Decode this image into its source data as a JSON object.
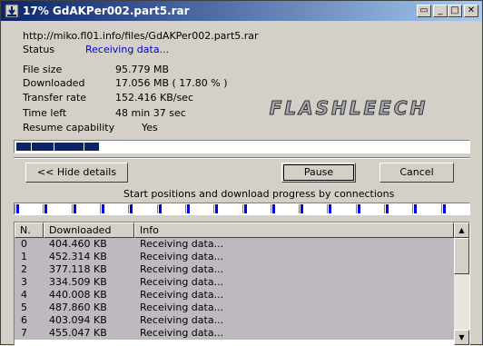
{
  "window": {
    "title": "17% GdAKPer002.part5.rar"
  },
  "titlebar_buttons": [
    "▭",
    "_",
    "□",
    "✕"
  ],
  "url": "http://miko.fl01.info/files/GdAKPer002.part5.rar",
  "status": {
    "label": "Status",
    "value": "Receiving data..."
  },
  "info": [
    {
      "label": "File size",
      "value": "95.779  MB"
    },
    {
      "label": "Downloaded",
      "value": "17.056  MB  ( 17.80 % )"
    },
    {
      "label": "Transfer rate",
      "value": "152.416  KB/sec"
    },
    {
      "label": "Time left",
      "value": "48 min 37 sec"
    },
    {
      "label": "Resume capability",
      "value": "Yes"
    }
  ],
  "logo_text": "FLASHLEECH",
  "progress": {
    "fraction": 0.178,
    "chunks": 11
  },
  "buttons": {
    "hide_details": "<< Hide details",
    "pause": "Pause",
    "cancel": "Cancel"
  },
  "connections_caption": "Start positions and download progress by connections",
  "connections_count": 16,
  "table": {
    "headers": [
      "N.",
      "Downloaded",
      "Info"
    ],
    "rows": [
      [
        "0",
        "404.460  KB",
        "Receiving data..."
      ],
      [
        "1",
        "452.314  KB",
        "Receiving data..."
      ],
      [
        "2",
        "377.118  KB",
        "Receiving data..."
      ],
      [
        "3",
        "334.509  KB",
        "Receiving data..."
      ],
      [
        "4",
        "440.008  KB",
        "Receiving data..."
      ],
      [
        "5",
        "487.860  KB",
        "Receiving data..."
      ],
      [
        "6",
        "403.094  KB",
        "Receiving data..."
      ],
      [
        "7",
        "455.047  KB",
        "Receiving data..."
      ]
    ]
  },
  "scrollbar": {
    "up": "▲",
    "down": "▼"
  },
  "colors": {
    "title_start": "#0a246a",
    "title_end": "#a6caf0",
    "progress": "#0a246a",
    "status_link": "#0000c8",
    "connection": "#0000e0"
  }
}
